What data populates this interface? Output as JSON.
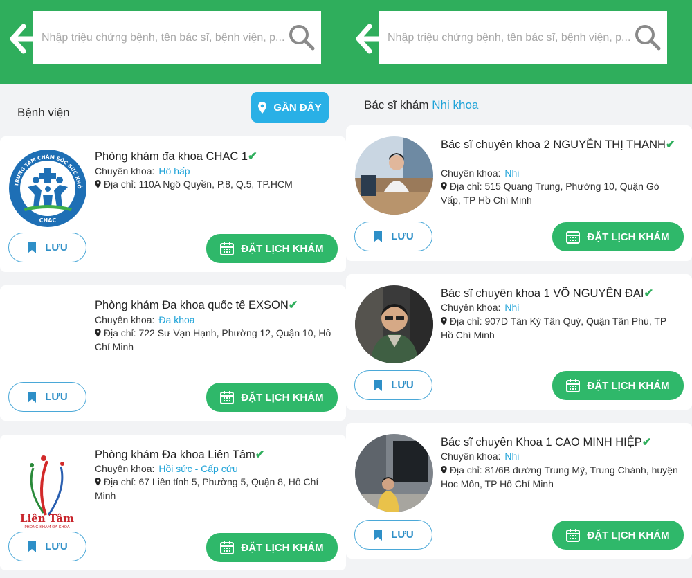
{
  "search": {
    "placeholder": "Nhập triệu chứng bệnh, tên bác sĩ, bệnh viện, p..."
  },
  "left": {
    "section_title": "Bệnh viện",
    "near_button": "GẦN ĐÂY",
    "logo_chac_text": "TRUNG TÂM CHĂM SÓC SỨC KHỎE CỘNG ĐỒNG",
    "logo_chac_abbr": "CHAC",
    "logo_lientam_name": "Liên Tâm",
    "logo_lientam_sub": "PHÒNG KHÁM ĐA KHOA",
    "cards": [
      {
        "name": "Phòng khám đa khoa CHAC 1",
        "specialty_label": "Chuyên khoa:",
        "specialty": "Hô hấp",
        "address_label": "Địa chỉ:",
        "address": "110A Ngô Quyền, P.8, Q.5, TP.HCM"
      },
      {
        "name": "Phòng khám Đa khoa quốc tế EXSON",
        "specialty_label": "Chuyên khoa:",
        "specialty": "Đa khoa",
        "address_label": "Địa chỉ:",
        "address": "722 Sư Vạn Hạnh, Phường 12, Quận 10, Hồ Chí Minh"
      },
      {
        "name": "Phòng khám Đa khoa Liên Tâm",
        "specialty_label": "Chuyên khoa:",
        "specialty": "Hồi sức - Cấp cứu",
        "address_label": "Địa chỉ:",
        "address": "67 Liên tỉnh 5, Phường 5, Quận 8, Hồ Chí Minh"
      }
    ]
  },
  "right": {
    "section_prefix": "Bác sĩ khám",
    "section_specialty": "Nhi khoa",
    "cards": [
      {
        "name": "Bác sĩ chuyên khoa 2 NGUYỄN THỊ THANH",
        "specialty_label": "Chuyên khoa:",
        "specialty": "Nhi",
        "address_label": "Địa chỉ:",
        "address": "515 Quang Trung, Phường 10, Quận Gò Vấp, TP Hồ Chí Minh"
      },
      {
        "name": "Bác sĩ chuyên khoa 1 VÕ NGUYÊN ĐẠI",
        "specialty_label": "Chuyên khoa:",
        "specialty": "Nhi",
        "address_label": "Địa chỉ:",
        "address": "907D Tân Kỳ Tân Quý, Quận Tân Phú, TP Hồ Chí Minh"
      },
      {
        "name": "Bác sĩ chuyên Khoa 1 CAO MINH HIỆP",
        "specialty_label": "Chuyên khoa:",
        "specialty": "Nhi",
        "address_label": "Địa chỉ:",
        "address": "81/6B đường Trung Mỹ, Trung Chánh, huyện Hoc Môn, TP Hồ Chí Minh"
      }
    ]
  },
  "buttons": {
    "save": "LƯU",
    "book": "ĐẶT LỊCH KHÁM"
  },
  "colors": {
    "header_green": "#2fae5c",
    "accent_blue": "#1fa3d8",
    "book_green": "#2fb86a",
    "near_blue": "#29b0e6"
  },
  "icons": [
    "back-arrow-icon",
    "search-icon",
    "location-pin-icon",
    "bookmark-icon",
    "calendar-icon",
    "verified-check-icon"
  ]
}
